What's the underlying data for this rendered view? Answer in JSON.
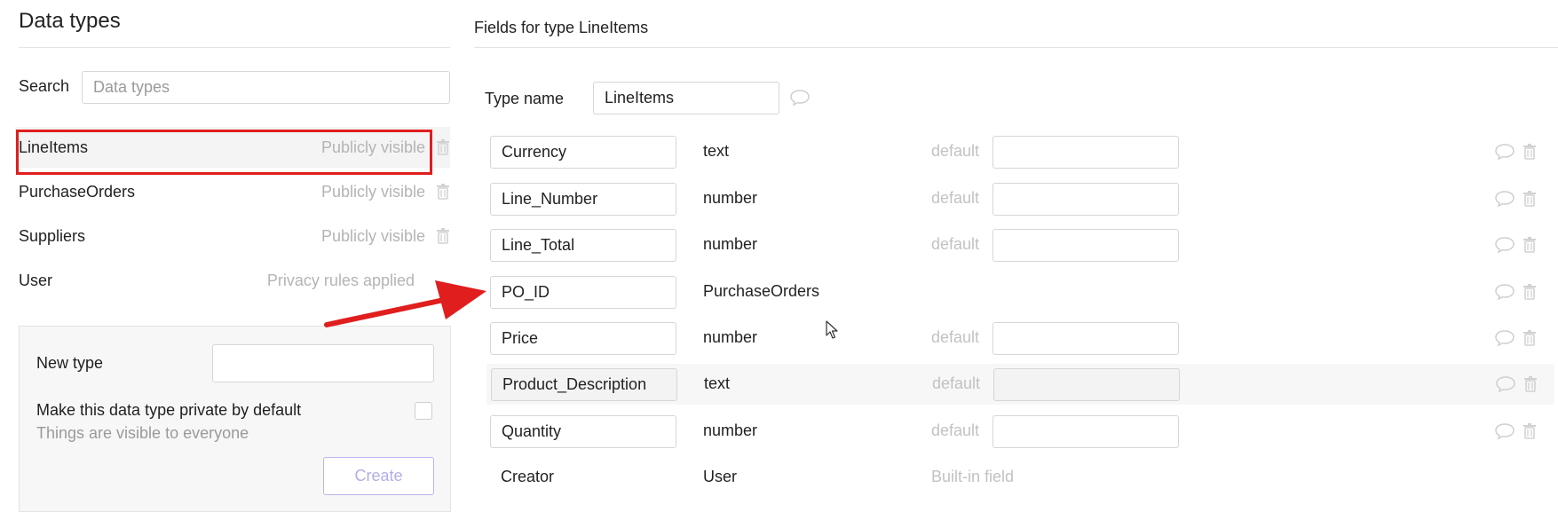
{
  "left": {
    "title": "Data types",
    "search_label": "Search",
    "search_placeholder": "Data types",
    "types": [
      {
        "name": "LineItems",
        "status": "Publicly visible"
      },
      {
        "name": "PurchaseOrders",
        "status": "Publicly visible"
      },
      {
        "name": "Suppliers",
        "status": "Publicly visible"
      },
      {
        "name": "User",
        "status": "Privacy rules applied"
      }
    ],
    "new_type": {
      "label": "New type",
      "private_label": "Make this data type private by default",
      "private_sub": "Things are visible to everyone",
      "create_label": "Create"
    }
  },
  "right": {
    "title": "Fields for type LineItems",
    "type_name_label": "Type name",
    "type_name_value": "LineItems",
    "default_label": "default",
    "fields": [
      {
        "name": "Currency",
        "type": "text"
      },
      {
        "name": "Line_Number",
        "type": "number"
      },
      {
        "name": "Line_Total",
        "type": "number"
      },
      {
        "name": "PO_ID",
        "type": "PurchaseOrders"
      },
      {
        "name": "Price",
        "type": "number"
      },
      {
        "name": "Product_Description",
        "type": "text"
      },
      {
        "name": "Quantity",
        "type": "number"
      },
      {
        "name": "Creator",
        "type": "User",
        "note": "Built-in field"
      }
    ]
  },
  "colors": {
    "annotation_red": "#e01e1e",
    "muted_text": "#b4b4b4",
    "create_button_border": "#b9b5ee"
  }
}
